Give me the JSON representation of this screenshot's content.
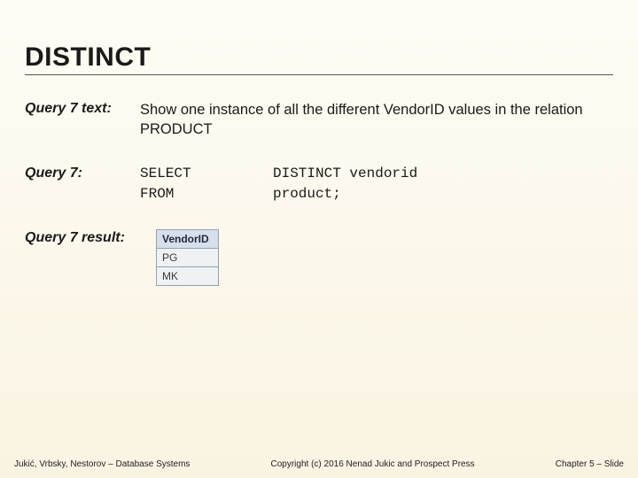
{
  "title": "DISTINCT",
  "sections": {
    "q7text": {
      "label": "Query 7 text:",
      "body": "Show one instance of all the different VendorID values in the relation PRODUCT"
    },
    "q7": {
      "label": "Query 7:",
      "sql": {
        "k1": "SELECT",
        "v1": "DISTINCT vendorid",
        "k2": "FROM",
        "v2": "product;"
      }
    },
    "q7result": {
      "label": "Query 7 result:",
      "table": {
        "header": "VendorID",
        "rows": [
          "PG",
          "MK"
        ]
      }
    }
  },
  "footer": {
    "left": "Jukić, Vrbsky, Nestorov – Database Systems",
    "center": "Copyright (c) 2016 Nenad Jukic and Prospect Press",
    "right": "Chapter 5 – Slide"
  }
}
